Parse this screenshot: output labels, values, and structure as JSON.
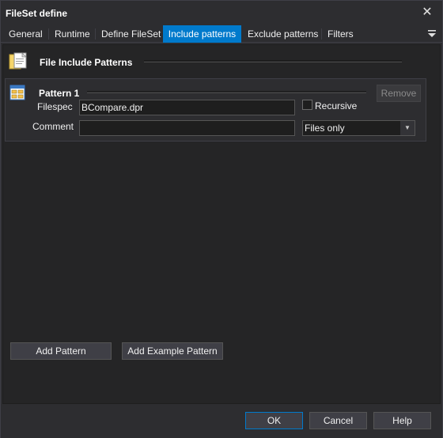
{
  "window": {
    "title": "FileSet define"
  },
  "tabs": [
    {
      "label": "General"
    },
    {
      "label": "Runtime"
    },
    {
      "label": "Define FileSet"
    },
    {
      "label": "Include patterns"
    },
    {
      "label": "Exclude patterns"
    },
    {
      "label": "Filters"
    }
  ],
  "active_tab": "Include patterns",
  "section": {
    "title": "File Include Patterns"
  },
  "pattern": {
    "title": "Pattern 1",
    "remove_label": "Remove",
    "filespec_label": "Filespec",
    "filespec_value": "BCompare.dpr",
    "recursive_label": "Recursive",
    "recursive_checked": false,
    "comment_label": "Comment",
    "comment_value": "",
    "type_selected": "Files only"
  },
  "actions": {
    "add_pattern": "Add Pattern",
    "add_example_pattern": "Add Example Pattern"
  },
  "footer": {
    "ok": "OK",
    "cancel": "Cancel",
    "help": "Help"
  },
  "colors": {
    "accent": "#007acc",
    "background": "#2d2d30",
    "panel": "#252526"
  }
}
